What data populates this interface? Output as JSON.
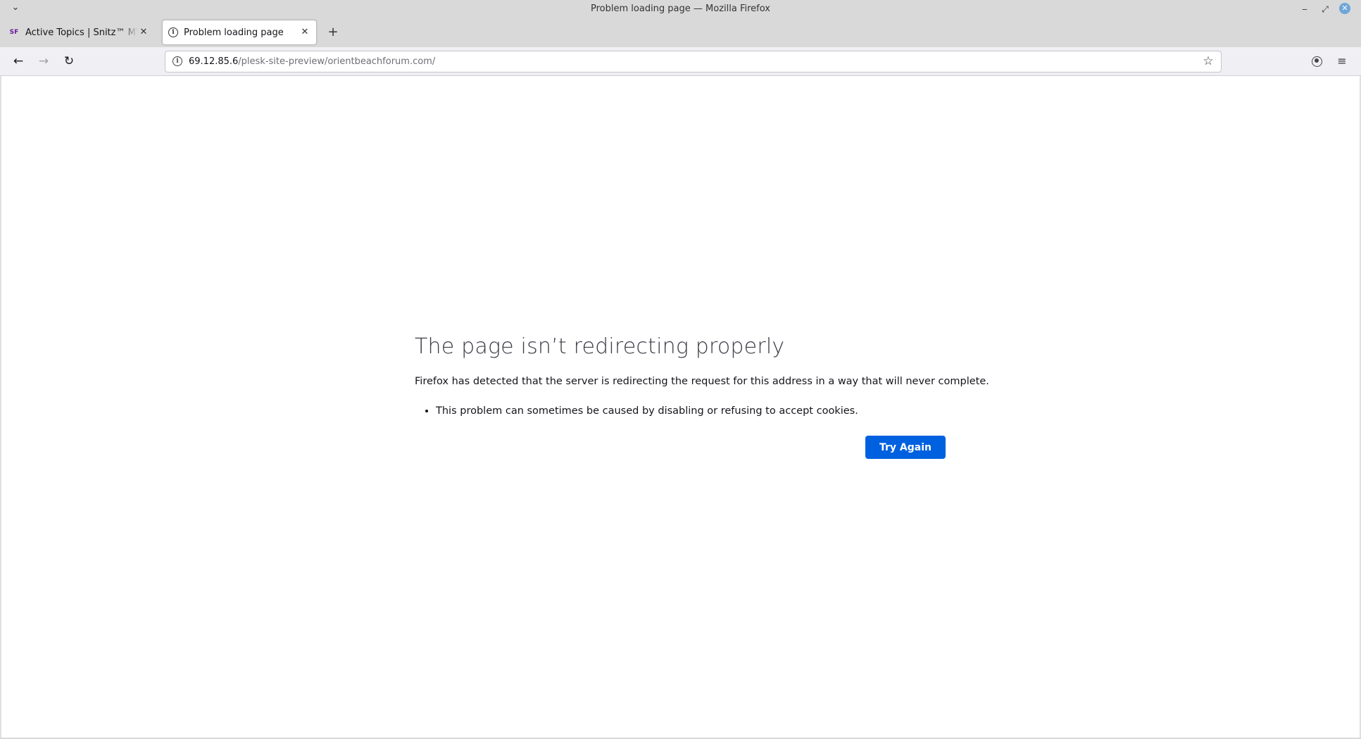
{
  "window": {
    "title": "Problem loading page — Mozilla Firefox",
    "menu_glyph": "⌄",
    "minimize_glyph": "‒",
    "maximize_glyph": "⤢",
    "close_glyph": "✕"
  },
  "tabs": [
    {
      "label": "Active Topics | Snitz™ MVC Forum",
      "favicon": "SF",
      "favicon_name": "snitz-favicon",
      "close_glyph": "✕",
      "active": false
    },
    {
      "label": "Problem loading page",
      "favicon": "i",
      "favicon_name": "info-icon",
      "close_glyph": "✕",
      "active": true
    }
  ],
  "new_tab_glyph": "+",
  "nav": {
    "back_glyph": "←",
    "forward_glyph": "→",
    "reload_glyph": "↻",
    "url_host": "69.12.85.6",
    "url_path": "/plesk-site-preview/orientbeachforum.com/",
    "info_glyph": "i",
    "bookmark_glyph": "☆",
    "menu_glyph": "≡"
  },
  "error": {
    "title": "The page isn’t redirecting properly",
    "description": "Firefox has detected that the server is redirecting the request for this address in a way that will never complete.",
    "bullets": [
      "This problem can sometimes be caused by disabling or refusing to accept cookies."
    ],
    "button_label": "Try Again"
  },
  "colors": {
    "accent": "#0061e0",
    "titlebar": "#d9d9d9",
    "toolbar": "#f0f0f4"
  }
}
